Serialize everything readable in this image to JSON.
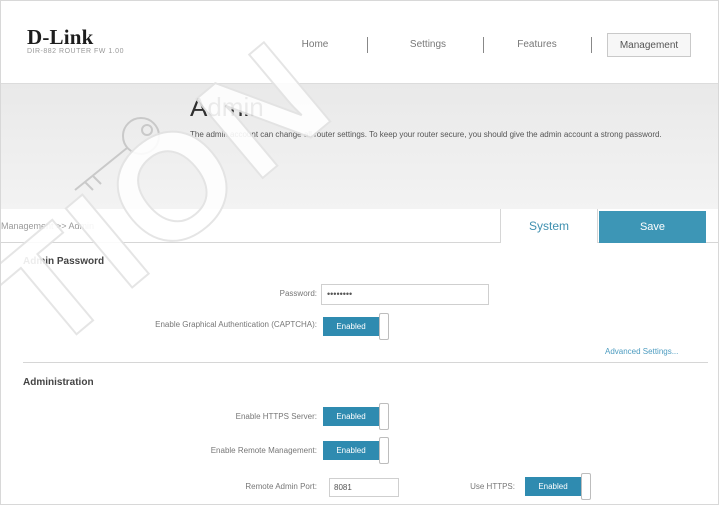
{
  "brand": {
    "logo": "D-Link",
    "model": "DIR-882 ROUTER FW 1.00"
  },
  "nav": {
    "items": [
      {
        "label": "Home"
      },
      {
        "label": "Settings"
      },
      {
        "label": "Features"
      },
      {
        "label": "Management"
      }
    ],
    "active": "Management"
  },
  "hero": {
    "title": "Admin",
    "description": "The admin account can change all router settings. To keep your router secure, you should give the admin account a strong password."
  },
  "breadcrumb": "Management >> Admin",
  "actions": {
    "system_label": "System",
    "save_label": "Save"
  },
  "admin_password": {
    "section_title": "Admin Password",
    "password_label": "Password:",
    "password_value": "••••••••",
    "captcha_label": "Enable Graphical Authentication (CAPTCHA):",
    "captcha_state": "Enabled",
    "advanced_link": "Advanced Settings..."
  },
  "administration": {
    "section_title": "Administration",
    "https_label": "Enable HTTPS Server:",
    "https_state": "Enabled",
    "remote_label": "Enable Remote Management:",
    "remote_state": "Enabled",
    "port_label": "Remote Admin Port:",
    "port_value": "8081",
    "use_https_label": "Use HTTPS:",
    "use_https_state": "Enabled"
  },
  "watermark": "TION",
  "colors": {
    "accent": "#3d96b6",
    "toggle_on": "#2f8bb0",
    "link": "#4d9cc0"
  }
}
